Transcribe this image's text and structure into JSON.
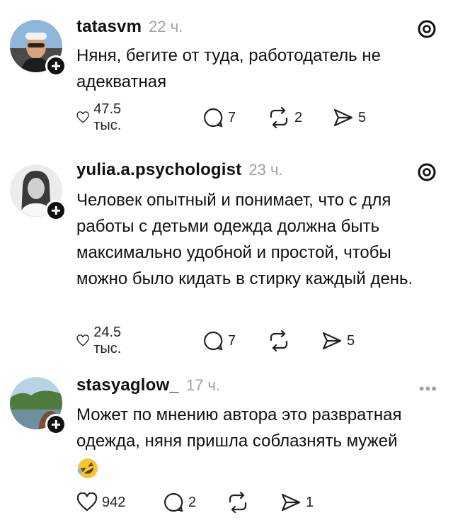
{
  "comments": [
    {
      "username": "tatasvm",
      "time": "22 ч.",
      "text": "Няня, бегите от туда,  работодатель не адекватная",
      "likes": "47.5 тыс.",
      "replies": "7",
      "reposts": "2",
      "shares": "5",
      "badge_icon": "threads-icon"
    },
    {
      "username": "yulia.a.psychologist",
      "time": "23 ч.",
      "text": "Человек опытный и понимает, что с для работы с  детьми одежда должна быть максимально удобной и простой, чтобы можно было кидать в стирку каждый день.",
      "likes": "24.5 тыс.",
      "replies": "7",
      "reposts": "",
      "shares": "5",
      "badge_icon": "threads-icon"
    },
    {
      "username": "stasyaglow_",
      "time": "17 ч.",
      "text": "Может по мнению автора это развратная одежда, няня пришла соблазнять мужей",
      "emoji": "rolling-on-floor-laughing",
      "likes": "942",
      "replies": "2",
      "reposts": "",
      "shares": "1",
      "menu": "•••"
    }
  ],
  "colors": {
    "text": "#111111",
    "muted": "#a2a2a2",
    "background": "#ffffff"
  }
}
